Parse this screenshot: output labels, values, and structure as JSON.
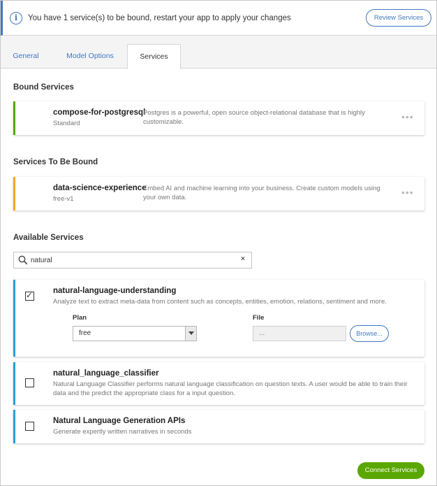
{
  "banner": {
    "info_icon": "i",
    "message": "You have 1 service(s) to be bound, restart your app to apply your changes",
    "review_button": "Review Services"
  },
  "tabs": [
    {
      "label": "General"
    },
    {
      "label": "Model Options"
    },
    {
      "label": "Services",
      "active": true
    }
  ],
  "bound": {
    "title": "Bound Services",
    "items": [
      {
        "name": "compose-for-postgresql",
        "plan": "Standard",
        "description": "Postgres is a powerful, open source object-relational database that is highly customizable.",
        "menu": "•••"
      }
    ]
  },
  "to_be_bound": {
    "title": "Services To Be Bound",
    "items": [
      {
        "name": "data-science-experience",
        "plan": "free-v1",
        "description": "Embed AI and machine learning into your business. Create custom models using your own data.",
        "menu": "•••"
      }
    ]
  },
  "available": {
    "title": "Available Services",
    "search_value": "natural",
    "clear": "×",
    "items": [
      {
        "name": "natural-language-understanding",
        "description": "Analyze text to extract meta-data from content such as concepts, entities, emotion, relations, sentiment and more.",
        "checked": true,
        "plan_label": "Plan",
        "plan_value": "free",
        "file_label": "File",
        "file_value": "...",
        "browse": "Browse..."
      },
      {
        "name": "natural_language_classifier",
        "description": "Natural Language Classifier performs natural language classification on question texts. A user would be able to train their data and the predict the appropriate class for a input question.",
        "checked": false
      },
      {
        "name": "Natural Language Generation APIs",
        "description": "Generate expertly written narratives in seconds",
        "checked": false
      }
    ]
  },
  "connect_button": "Connect Services",
  "colors": {
    "accent": "#4178be",
    "bound": "#5aa700",
    "pending": "#f5a623",
    "available": "#2a9fd8"
  }
}
